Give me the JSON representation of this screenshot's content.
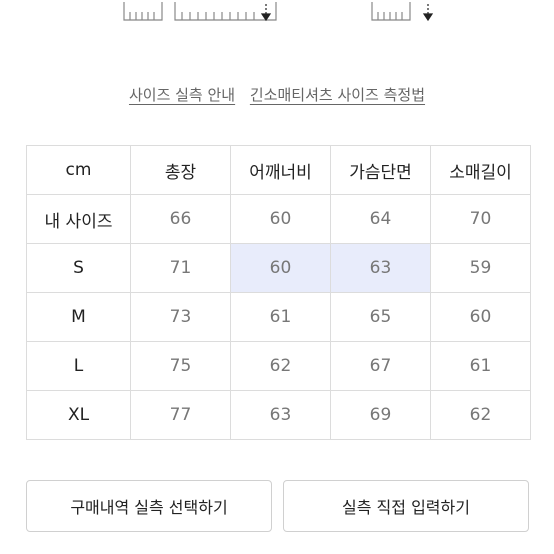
{
  "guide": {
    "link1": "사이즈 실측 안내",
    "link2": "긴소매티셔츠 사이즈 측정법"
  },
  "table": {
    "headers": [
      "cm",
      "총장",
      "어깨너비",
      "가슴단면",
      "소매길이"
    ],
    "rows": [
      {
        "label": "내 사이즈",
        "values": [
          "66",
          "60",
          "64",
          "70"
        ]
      },
      {
        "label": "S",
        "values": [
          "71",
          "60",
          "63",
          "59"
        ]
      },
      {
        "label": "M",
        "values": [
          "73",
          "61",
          "65",
          "60"
        ]
      },
      {
        "label": "L",
        "values": [
          "75",
          "62",
          "67",
          "61"
        ]
      },
      {
        "label": "XL",
        "values": [
          "77",
          "63",
          "69",
          "62"
        ]
      }
    ],
    "highlight_color": "#e8ecfb"
  },
  "buttons": {
    "purchase_history": "구매내역 실측 선택하기",
    "direct_input": "실측 직접 입력하기"
  }
}
